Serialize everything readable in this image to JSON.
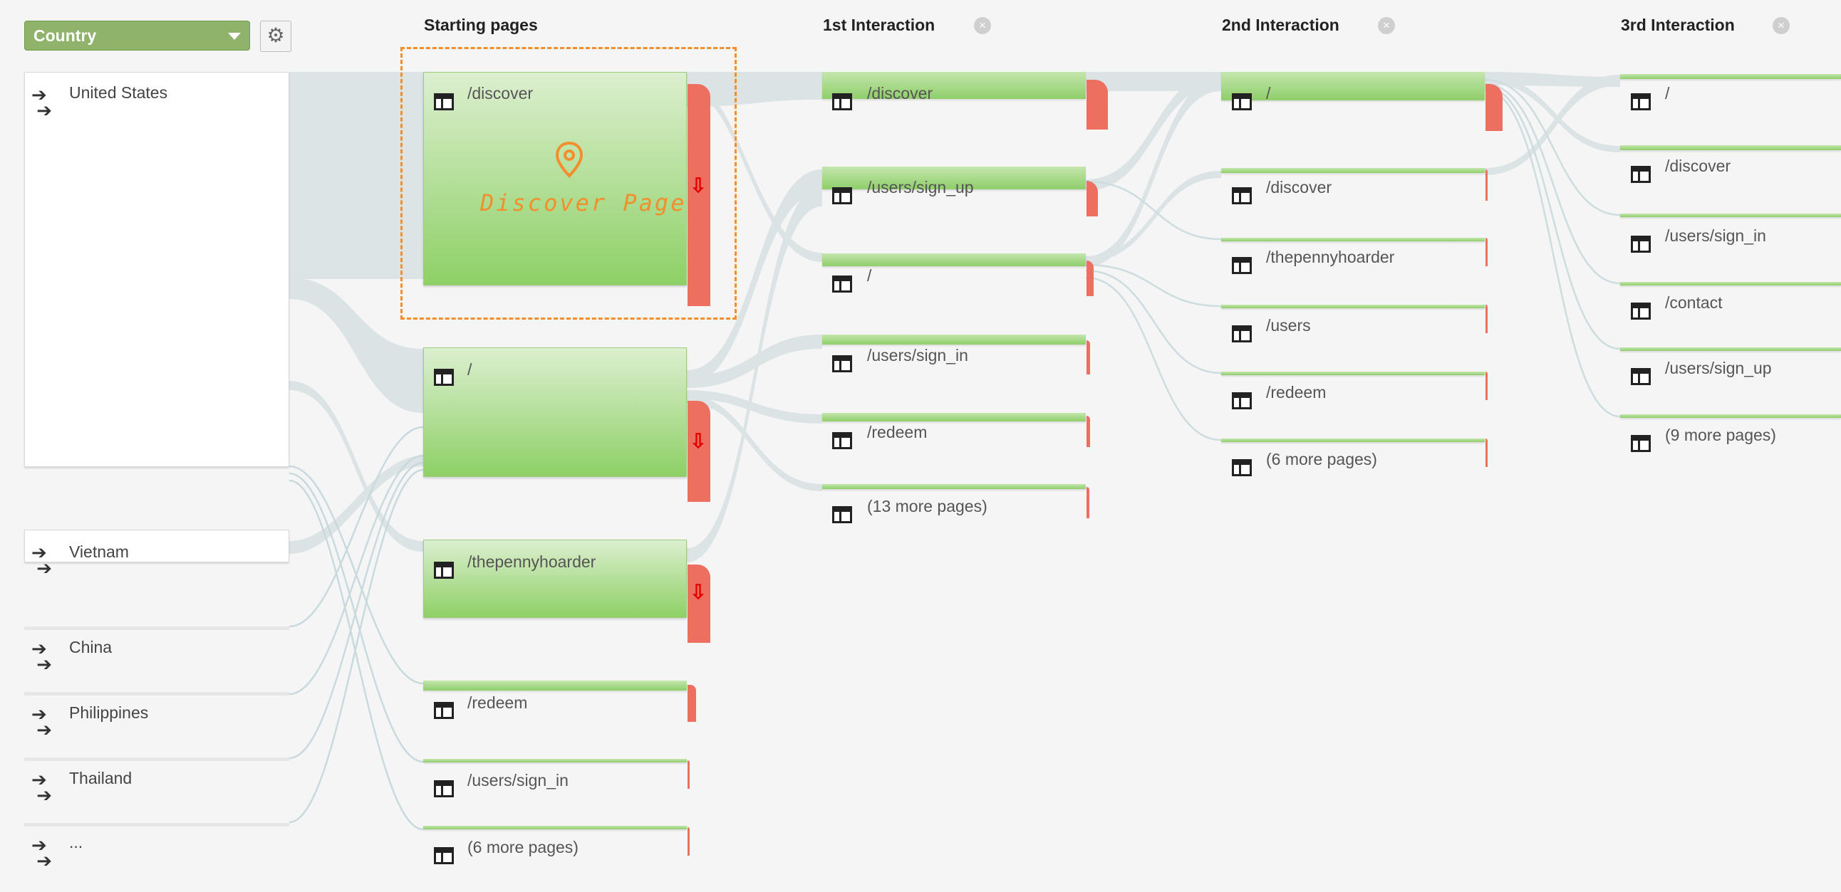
{
  "header": {
    "dimension_selector": {
      "value": "Country"
    },
    "settings_icon": "gear-icon"
  },
  "columns": {
    "starting": {
      "title": "Starting pages"
    },
    "interaction1": {
      "title": "1st Interaction",
      "close_icon": "close-icon"
    },
    "interaction2": {
      "title": "2nd Interaction",
      "close_icon": "close-icon"
    },
    "interaction3": {
      "title": "3rd Interaction",
      "close_icon": "close-icon"
    }
  },
  "countries": [
    {
      "label": "United States"
    },
    {
      "label": "Vietnam"
    },
    {
      "label": "China"
    },
    {
      "label": "Philippines"
    },
    {
      "label": "Thailand"
    },
    {
      "label": "..."
    }
  ],
  "starting_pages": [
    {
      "label": "/discover"
    },
    {
      "label": "/"
    },
    {
      "label": "/thepennyhoarder"
    },
    {
      "label": "/redeem"
    },
    {
      "label": "/users/sign_in"
    },
    {
      "label": "(6 more pages)"
    }
  ],
  "interaction1": [
    {
      "label": "/discover"
    },
    {
      "label": "/users/sign_up"
    },
    {
      "label": "/"
    },
    {
      "label": "/users/sign_in"
    },
    {
      "label": "/redeem"
    },
    {
      "label": "(13 more pages)"
    }
  ],
  "interaction2": [
    {
      "label": "/"
    },
    {
      "label": "/discover"
    },
    {
      "label": "/thepennyhoarder"
    },
    {
      "label": "/users"
    },
    {
      "label": "/redeem"
    },
    {
      "label": "(6 more pages)"
    }
  ],
  "interaction3": [
    {
      "label": "/"
    },
    {
      "label": "/discover"
    },
    {
      "label": "/users/sign_in"
    },
    {
      "label": "/contact"
    },
    {
      "label": "/users/sign_up"
    },
    {
      "label": "(9 more pages)"
    }
  ],
  "annotation": {
    "label": "Discover Page",
    "icon": "location-pin-icon",
    "color": "#f28e2c"
  },
  "colors": {
    "node_green": "#8ed066",
    "dropoff_red": "#ec6f60",
    "flow_gray": "#d4dfe1"
  }
}
